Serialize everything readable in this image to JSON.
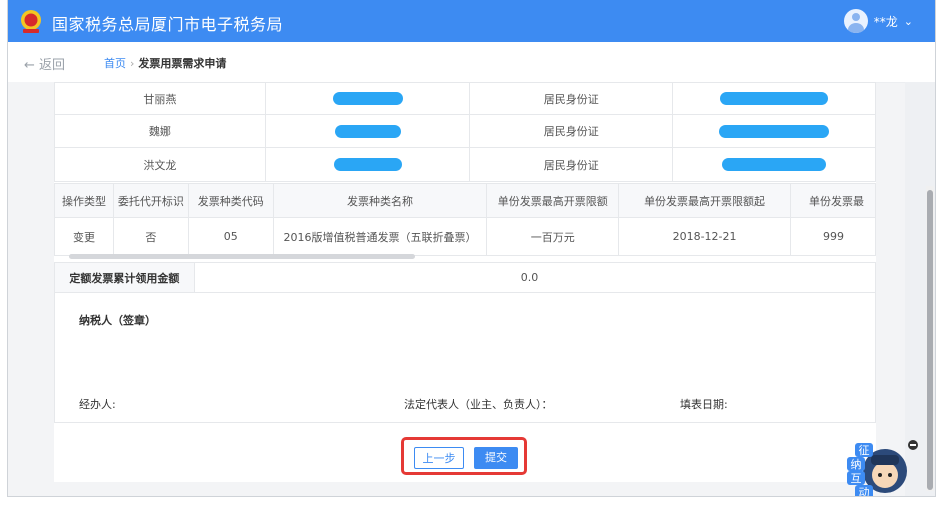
{
  "header": {
    "title": "国家税务总局厦门市电子税务局",
    "user_name": "**龙",
    "user_menu_caret": "⌄"
  },
  "breadcrumb": {
    "back_label": "← 返回",
    "home": "首页",
    "separator": "›",
    "current": "发票用票需求申请"
  },
  "people": [
    {
      "name": "甘丽燕",
      "id_type": "居民身份证"
    },
    {
      "name": "魏娜",
      "id_type": "居民身份证"
    },
    {
      "name": "洪文龙",
      "id_type": "居民身份证"
    }
  ],
  "invoice_table": {
    "headers": [
      "操作类型",
      "委托代开标识",
      "发票种类代码",
      "发票种类名称",
      "单份发票最高开票限额",
      "单份发票最高开票限额起",
      "单份发票最"
    ],
    "row": [
      "变更",
      "否",
      "05",
      "2016版增值税普通发票（五联折叠票）",
      "一百万元",
      "2018-12-21",
      "999"
    ]
  },
  "quota": {
    "label": "定额发票累计领用金额",
    "value": "0.0"
  },
  "signature": {
    "taxpayer": "纳税人（签章）",
    "handler": "经办人:",
    "legal_rep": "法定代表人（业主、负责人）：",
    "fill_date": "填表日期:"
  },
  "actions": {
    "prev": "上一步",
    "submit": "提交"
  },
  "mascot": {
    "chars": [
      "征",
      "纳",
      "互",
      "动"
    ]
  },
  "colors": {
    "brand": "#3d8bf2",
    "redaction": "#2aa6f5",
    "highlight": "#e53935"
  }
}
